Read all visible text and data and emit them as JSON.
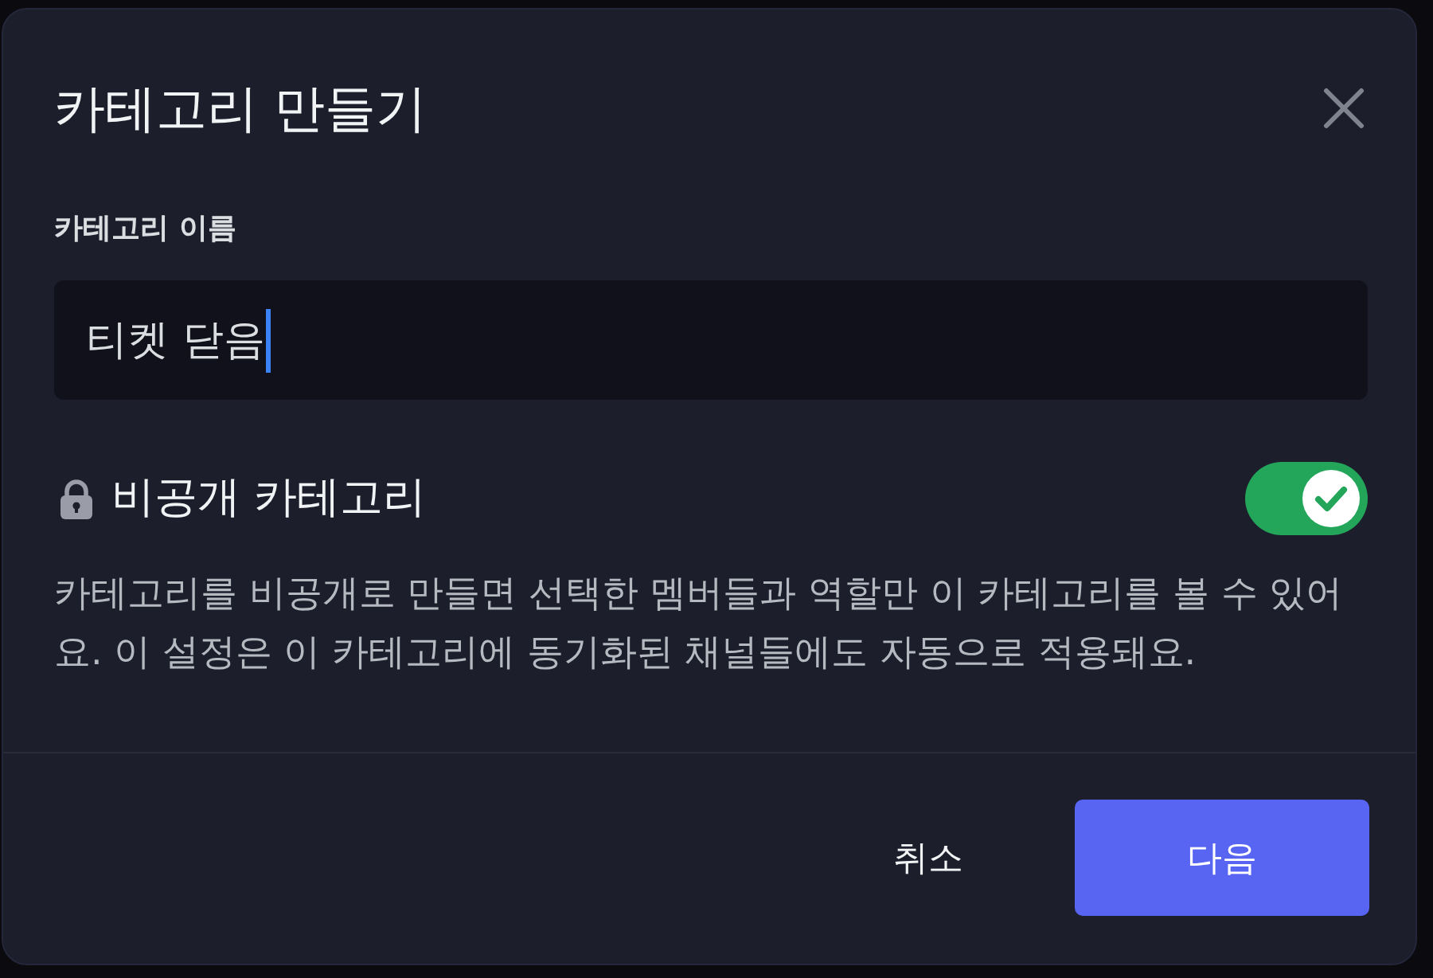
{
  "dialog": {
    "title": "카테고리 만들기"
  },
  "name_field": {
    "label": "카테고리 이름",
    "value": "티켓 닫음",
    "focused": true
  },
  "private_setting": {
    "label": "비공개 카테고리",
    "on": true,
    "description": "카테고리를 비공개로 만들면 선택한 멤버들과 역할만 이 카테고리를 볼 수 있어요. 이 설정은 이 카테고리에 동기화된 채널들에도 자동으로 적용돼요."
  },
  "buttons": [
    {
      "label": "취소",
      "kind": "secondary"
    },
    {
      "label": "다음",
      "kind": "primary"
    }
  ]
}
